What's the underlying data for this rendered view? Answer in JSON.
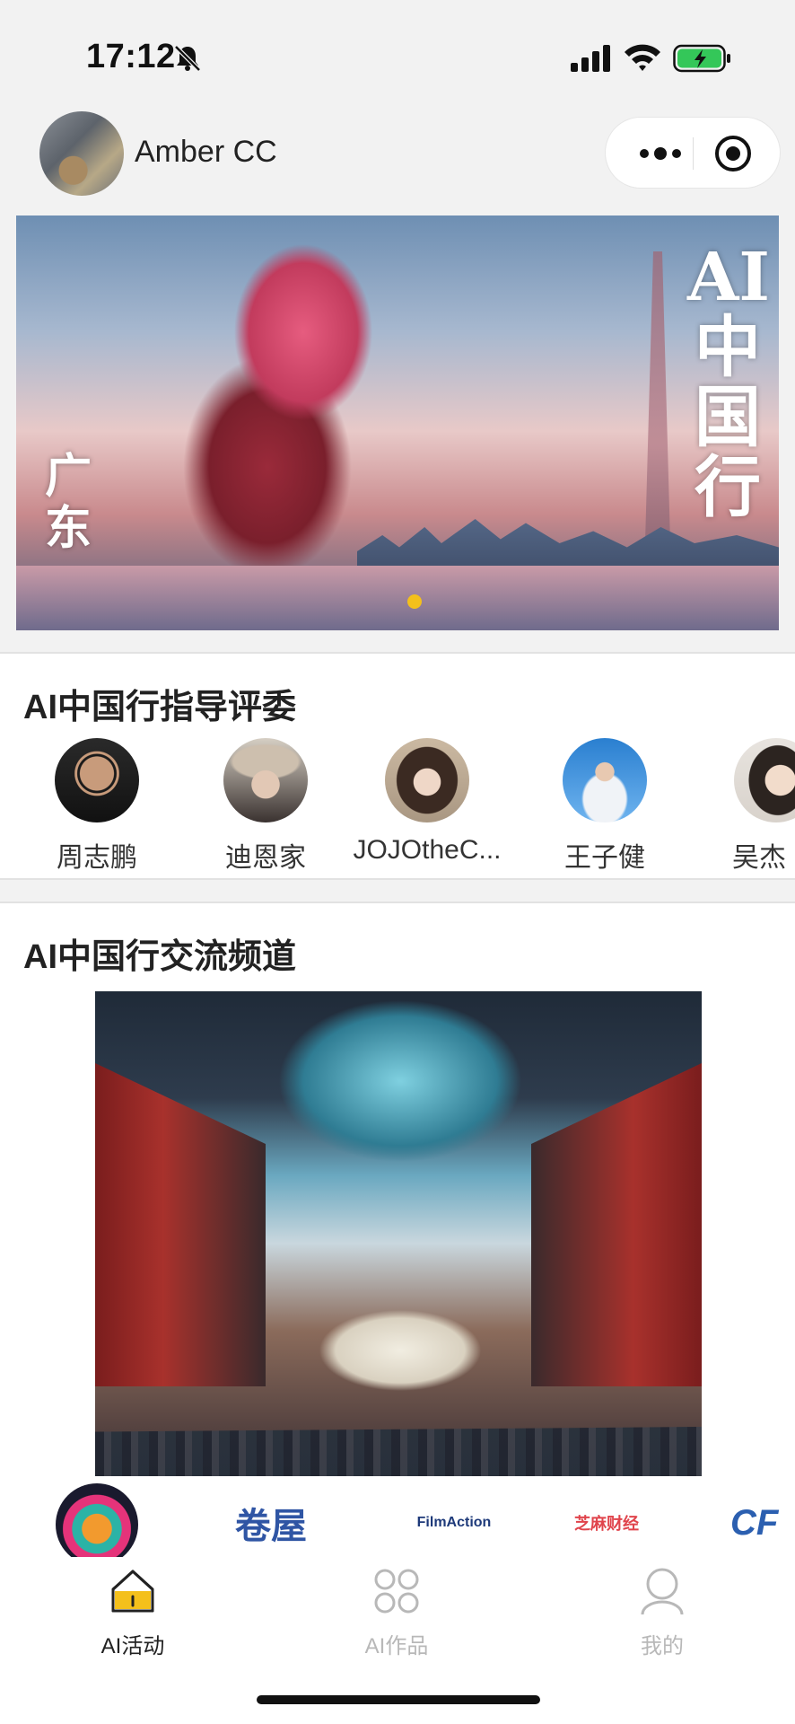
{
  "status_bar": {
    "time": "17:12"
  },
  "header": {
    "username": "Amber CC"
  },
  "banner": {
    "title_vertical": "AI中国行",
    "title_left": "广东"
  },
  "judges": {
    "title": "AI中国行指导评委",
    "items": [
      {
        "name": "周志鹏",
        "color_a": "#2a2a2a",
        "color_b": "#c89b7b"
      },
      {
        "name": "迪恩家",
        "color_a": "#d6cfc4",
        "color_b": "#5a4a3e"
      },
      {
        "name": "JOJOtheC...",
        "color_a": "#cbb9a2",
        "color_b": "#3b2a22"
      },
      {
        "name": "王子健",
        "color_a": "#2a7fd0",
        "color_b": "#f0f3f7"
      },
      {
        "name": "吴杰",
        "color_a": "#e8e4df",
        "color_b": "#2c2420"
      }
    ]
  },
  "channel": {
    "title": "AI中国行交流频道",
    "partners": [
      "卷屋",
      "FilmAction",
      "芝麻财经",
      "CF"
    ]
  },
  "tabbar": {
    "items": [
      {
        "label": "AI活动",
        "icon": "home-icon",
        "active": true
      },
      {
        "label": "AI作品",
        "icon": "grid-icon",
        "active": false
      },
      {
        "label": "我的",
        "icon": "user-icon",
        "active": false
      }
    ]
  },
  "colors": {
    "accent": "#f4c01b",
    "battery": "#34c759",
    "inactive": "#b8b8b8"
  }
}
